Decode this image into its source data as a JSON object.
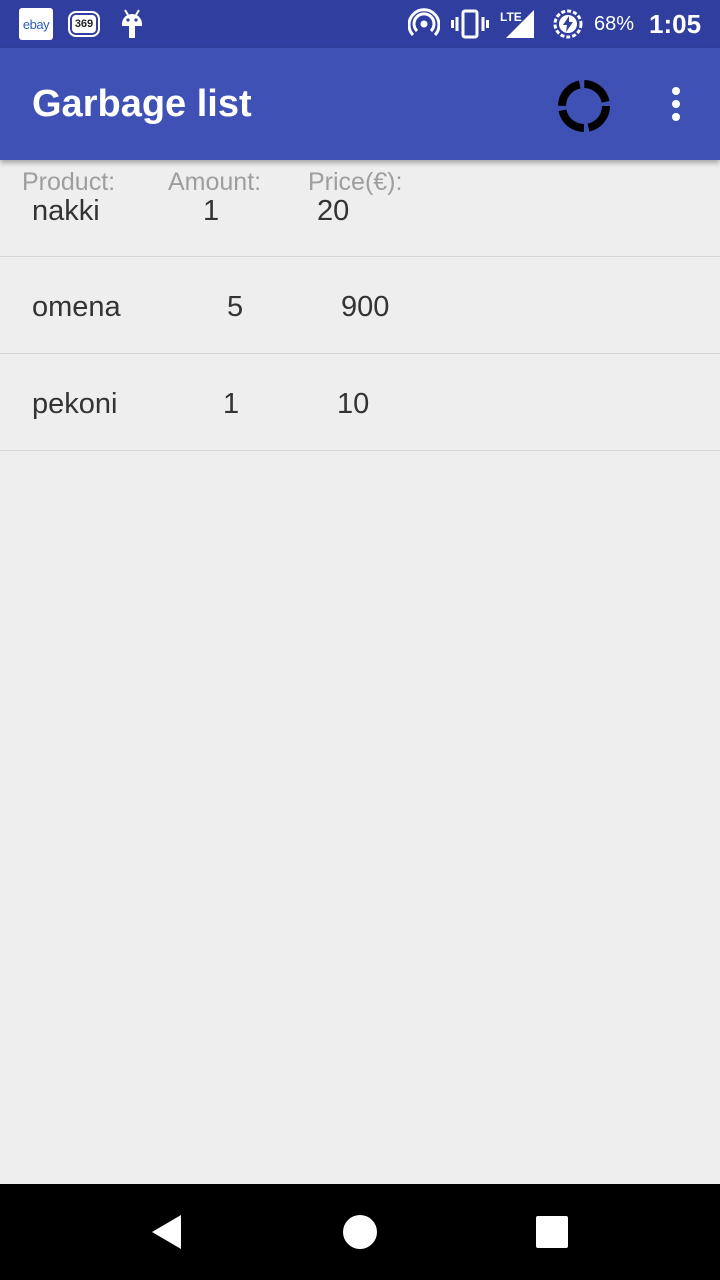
{
  "status_bar": {
    "ebay_label": "ebay",
    "badge_369": "369",
    "battery_percent": "68%",
    "time": "1:05",
    "network_label": "LTE"
  },
  "app_bar": {
    "title": "Garbage list"
  },
  "table": {
    "headers": [
      "Product:",
      "Amount:",
      "Price(€):"
    ],
    "rows": [
      {
        "product": "nakki",
        "amount": "1",
        "price": "20"
      },
      {
        "product": "omena",
        "amount": "5",
        "price": "900"
      },
      {
        "product": "pekoni",
        "amount": "1",
        "price": "10"
      }
    ]
  },
  "colors": {
    "status_bar": "#303f9f",
    "app_bar": "#3f51b5",
    "background": "#eeeeee"
  },
  "icons": [
    "ebay-icon",
    "badge-369-icon",
    "android-icon",
    "hotspot-icon",
    "vibrate-icon",
    "lte-signal-icon",
    "battery-charging-icon",
    "loading-spinner-icon",
    "overflow-menu-icon",
    "back-icon",
    "home-icon",
    "recents-icon"
  ]
}
